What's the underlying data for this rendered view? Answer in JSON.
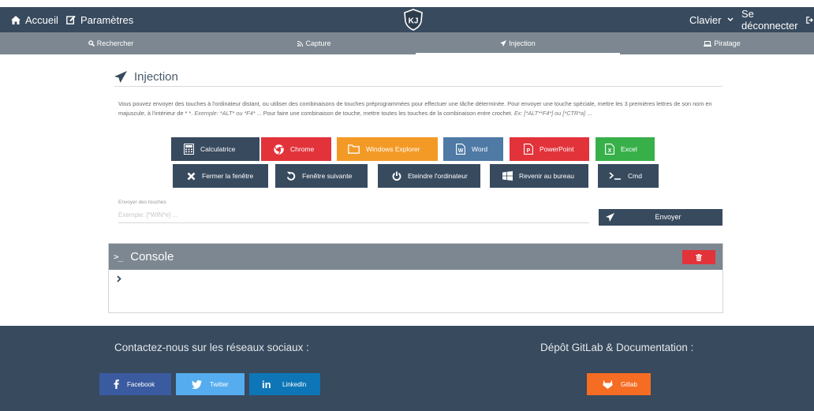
{
  "topbar": {
    "home_label": "Accueil",
    "settings_label": "Paramètres",
    "logo_text": "KJ",
    "keyboard_label": "Clavier",
    "logout_label": "Se déconnecter"
  },
  "tabs": [
    {
      "label": "Rechercher",
      "icon": "search-icon",
      "active": false
    },
    {
      "label": "Capture",
      "icon": "rss-icon",
      "active": false
    },
    {
      "label": "Injection",
      "icon": "paper-plane-icon",
      "active": true
    },
    {
      "label": "Piratage",
      "icon": "laptop-icon",
      "active": false
    }
  ],
  "section": {
    "title": "Injection",
    "description_part1": "Vous pouvez envoyer des touches à l'ordinateur distant, ou utiliser des combinaisons de touches préprogrammées pour effectuer une tâche déterminée. Pour envoyer une touche spéciale, mettre les 3 premières lettres de son nom en majuscule, à l'intérieur de * *.",
    "description_example1": "Exemple: *ALT* ou *F4*",
    "description_part2": "... Pour faire une combinaison de touche, mettre toutes les touches de la combinaison entre crochet.",
    "description_example2": "Ex: [*ALT**F4*] ou [*CTR*a]",
    "description_part3": "..."
  },
  "shortcuts": {
    "row1": [
      {
        "label": "Calculatrice",
        "icon": "calculator-icon",
        "color": "#384a5e"
      },
      {
        "label": "Chrome",
        "icon": "chrome-icon",
        "color": "#e2333b"
      },
      {
        "label": "Windows Explorer",
        "icon": "folder-icon",
        "color": "#f39a26"
      },
      {
        "label": "Word",
        "icon": "word-file-icon",
        "color": "#4e7aa5"
      },
      {
        "label": "PowerPoint",
        "icon": "powerpoint-file-icon",
        "color": "#e2333b"
      },
      {
        "label": "Excel",
        "icon": "excel-file-icon",
        "color": "#38b04a"
      }
    ],
    "row2": [
      {
        "label": "Fermer la fenêtre",
        "icon": "close-icon",
        "color": "#384a5e"
      },
      {
        "label": "Fenêtre suivante",
        "icon": "undo-icon",
        "color": "#384a5e"
      },
      {
        "label": "Eteindre l'ordinateur",
        "icon": "power-icon",
        "color": "#384a5e"
      },
      {
        "label": "Revenir au bureau",
        "icon": "windows-icon",
        "color": "#384a5e"
      },
      {
        "label": "Cmd",
        "icon": "terminal-icon",
        "color": "#384a5e"
      }
    ]
  },
  "send_keys": {
    "label": "Envoyer des touches",
    "placeholder": "Exemple: [*WIN*e] ...",
    "value": "",
    "button_label": "Envoyer"
  },
  "console": {
    "title": "Console",
    "icon_text": ">_"
  },
  "footer": {
    "social_title": "Contactez-nous sur les réseaux sociaux :",
    "repo_title": "Dépôt GitLab & Documentation :",
    "facebook_label": "Facebook",
    "twitter_label": "Twitter",
    "linkedin_label": "LinkedIn",
    "gitlab_label": "Gitlab"
  },
  "colors": {
    "navbar": "#384a5e",
    "tabbar": "#7c8791",
    "danger": "#e2333b",
    "warning": "#f39a26",
    "success": "#38b04a",
    "facebook": "#3b5ba0",
    "twitter": "#55acee",
    "linkedin": "#0e76b7",
    "gitlab": "#f56c23"
  }
}
